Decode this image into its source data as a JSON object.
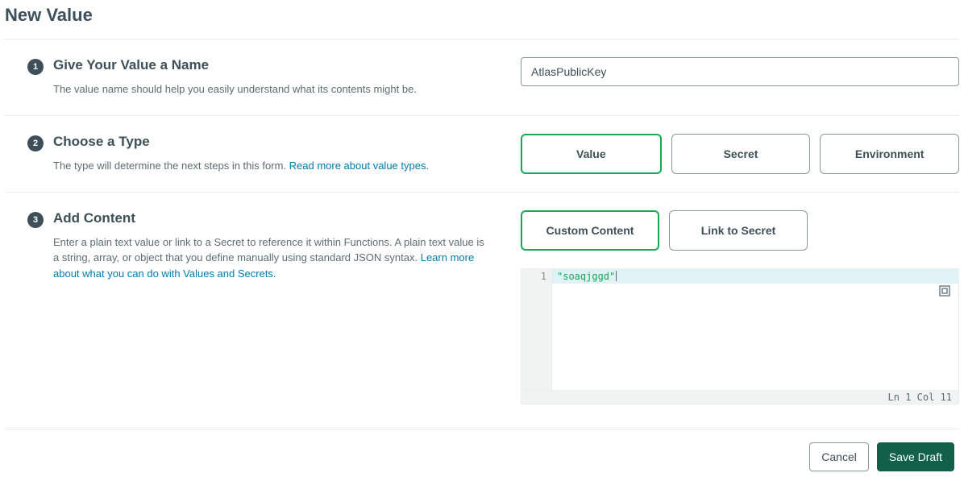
{
  "page_title": "New Value",
  "steps": [
    {
      "num": "1",
      "title": "Give Your Value a Name",
      "desc": "The value name should help you easily understand what its contents might be."
    },
    {
      "num": "2",
      "title": "Choose a Type",
      "desc_prefix": "The type will determine the next steps in this form. ",
      "link": "Read more about value types."
    },
    {
      "num": "3",
      "title": "Add Content",
      "desc_prefix": "Enter a plain text value or link to a Secret to reference it within Functions. A plain text value is a string, array, or object that you define manually using standard JSON syntax. ",
      "link": "Learn more about what you can do with Values and Secrets."
    }
  ],
  "name_input_value": "AtlasPublicKey",
  "type_options": {
    "value": "Value",
    "secret": "Secret",
    "environment": "Environment"
  },
  "content_options": {
    "custom": "Custom Content",
    "secret": "Link to Secret"
  },
  "editor": {
    "line_num": "1",
    "content": "\"soaqjggd\"",
    "status": "Ln 1 Col 11"
  },
  "footer": {
    "cancel": "Cancel",
    "save": "Save Draft"
  }
}
